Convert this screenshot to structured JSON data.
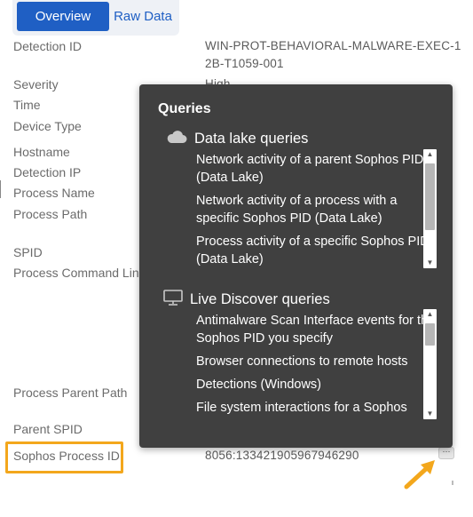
{
  "tabs": {
    "overview": "Overview",
    "raw_data": "Raw Data"
  },
  "fields": {
    "detection_id": {
      "label": "Detection ID",
      "value_line1": "WIN-PROT-BEHAVIORAL-MALWARE-EXEC-1",
      "value_line2": "2B-T1059-001"
    },
    "severity": {
      "label": "Severity",
      "value": "High"
    },
    "time": {
      "label": "Time"
    },
    "device_type": {
      "label": "Device Type"
    },
    "hostname": {
      "label": "Hostname"
    },
    "detection_ip": {
      "label": "Detection IP"
    },
    "process_name": {
      "label": "Process Name"
    },
    "process_path": {
      "label": "Process Path"
    },
    "spid": {
      "label": "SPID"
    },
    "process_command_line": {
      "label": "Process Command Line"
    },
    "process_parent_path": {
      "label": "Process Parent Path"
    },
    "parent_spid": {
      "label": "Parent SPID"
    },
    "sophos_process_id": {
      "label": "Sophos Process ID",
      "value": "8056:133421905967946290"
    }
  },
  "more_button": {
    "label": "···"
  },
  "popover": {
    "title": "Queries",
    "data_lake": {
      "heading": "Data lake queries",
      "icon": "cloud-icon",
      "items": [
        "Network activity of a parent Sophos PID (Data Lake)",
        "Network activity of a process with a specific Sophos PID (Data Lake)",
        "Process activity of a specific Sophos PID (Data Lake)"
      ]
    },
    "live_discover": {
      "heading": "Live Discover queries",
      "icon": "monitor-icon",
      "items": [
        "Antimalware Scan Interface events for the Sophos PID you specify",
        "Browser connections to remote hosts",
        "Detections (Windows)",
        "File system interactions for a Sophos"
      ]
    }
  },
  "colors": {
    "accent": "#1f5fc4",
    "highlight": "#f3a71c",
    "popover_bg": "#404040"
  }
}
